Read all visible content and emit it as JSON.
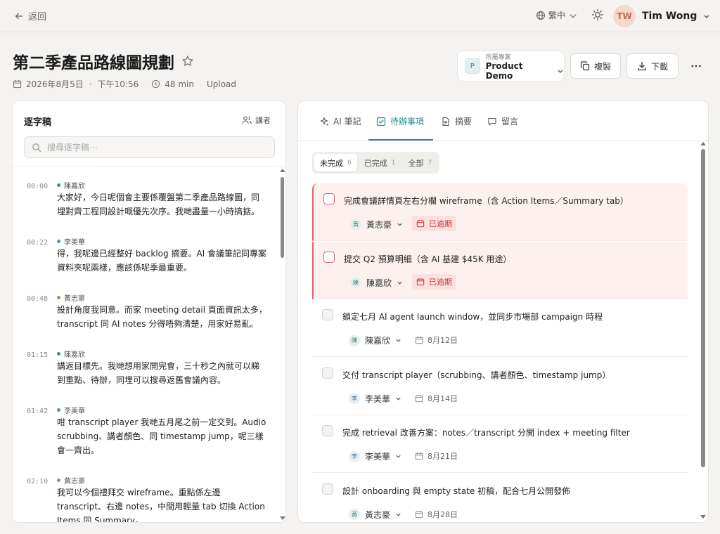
{
  "topbar": {
    "back_label": "返回",
    "language": "繁中",
    "user": {
      "initials": "TW",
      "name": "Tim Wong"
    }
  },
  "header": {
    "title": "第二季產品路線圖規劃",
    "date": "2026年8月5日",
    "time": "下午10:56",
    "duration": "48 min",
    "source": "Upload",
    "project": {
      "badge": "P",
      "label": "所屬專案",
      "name": "Product Demo"
    },
    "copy_label": "複製",
    "download_label": "下載"
  },
  "transcript": {
    "title": "逐字稿",
    "speaker_button": "講者",
    "search_placeholder": "搜尋逐字稿⋯",
    "entries": [
      {
        "time": "00:00",
        "speaker": "陳嘉欣",
        "color": "#3f8f8f",
        "lines": [
          "大家好，今日呢個會主要係覆盤第二季產品路線圖，同",
          "埋對齊工程同設計嘅優先次序。我哋盡量一小時搞掂。"
        ]
      },
      {
        "time": "00:22",
        "speaker": "李美華",
        "color": "#5b8fb3",
        "lines": [
          "得，我呢邊已經整好 backlog 摘要。AI 會議筆記同專案",
          "資料夾呢兩樣，應該係呢季最重要。"
        ]
      },
      {
        "time": "00:48",
        "speaker": "黃志豪",
        "color": "#b3875b",
        "lines": [
          "設計角度我同意。而家 meeting detail 頁面資訊太多，",
          "transcript 同 AI notes 分得唔夠清楚，用家好易亂。"
        ]
      },
      {
        "time": "01:15",
        "speaker": "陳嘉欣",
        "color": "#3f8f8f",
        "lines": [
          "講返目標先。我哋想用家開完會，三十秒之內就可以睇",
          "到重點、待辦，同埋可以搜尋返舊會議內容。"
        ]
      },
      {
        "time": "01:42",
        "speaker": "李美華",
        "color": "#5b8fb3",
        "lines": [
          "咁 transcript player 我哋五月尾之前一定交到。Audio",
          "scrubbing、講者顏色、同 timestamp jump，呢三樣",
          "會一齊出。"
        ]
      },
      {
        "time": "02:10",
        "speaker": "黃志豪",
        "color": "#b3875b",
        "lines": [
          "我可以今個禮拜交 wireframe。重點係左邊",
          "transcript、右邊 notes，中間用輕量 tab 切換 Action",
          "Items 同 Summary。"
        ]
      }
    ]
  },
  "tabs": [
    {
      "label": "AI 筆記",
      "icon": "sparkle-icon"
    },
    {
      "label": "待辦事項",
      "icon": "checkbox-icon"
    },
    {
      "label": "摘要",
      "icon": "document-icon"
    },
    {
      "label": "留言",
      "icon": "comment-icon"
    }
  ],
  "filters": [
    {
      "label": "未完成",
      "count": "6"
    },
    {
      "label": "已完成",
      "count": "1"
    },
    {
      "label": "全部",
      "count": "7"
    }
  ],
  "tasks": [
    {
      "text": "完成會議詳情頁左右分欄 wireframe（含 Action Items／Summary tab）",
      "assignee": "黃志豪",
      "avatar": "黃",
      "due": "已逾期",
      "overdue": true
    },
    {
      "text": "提交 Q2 預算明細（含 AI 基建 $45K 用途）",
      "assignee": "陳嘉欣",
      "avatar": "陳",
      "due": "已逾期",
      "overdue": true
    },
    {
      "text": "鎖定七月 AI agent launch window，並同步市場部 campaign 時程",
      "assignee": "陳嘉欣",
      "avatar": "陳",
      "due": "8月12日",
      "overdue": false
    },
    {
      "text": "交付 transcript player（scrubbing、講者顏色、timestamp jump）",
      "assignee": "李美華",
      "avatar": "李",
      "due": "8月14日",
      "overdue": false
    },
    {
      "text": "完成 retrieval 改善方案：notes／transcript 分開 index + meeting filter",
      "assignee": "李美華",
      "avatar": "李",
      "due": "8月21日",
      "overdue": false
    },
    {
      "text": "設計 onboarding 與 empty state 初稿，配合七月公開發佈",
      "assignee": "黃志豪",
      "avatar": "黃",
      "due": "8月28日",
      "overdue": false
    }
  ],
  "colors": {
    "accent": "#2a8a8a",
    "overdue": "#c9373d",
    "overdue_bg": "#fdf1f0"
  }
}
